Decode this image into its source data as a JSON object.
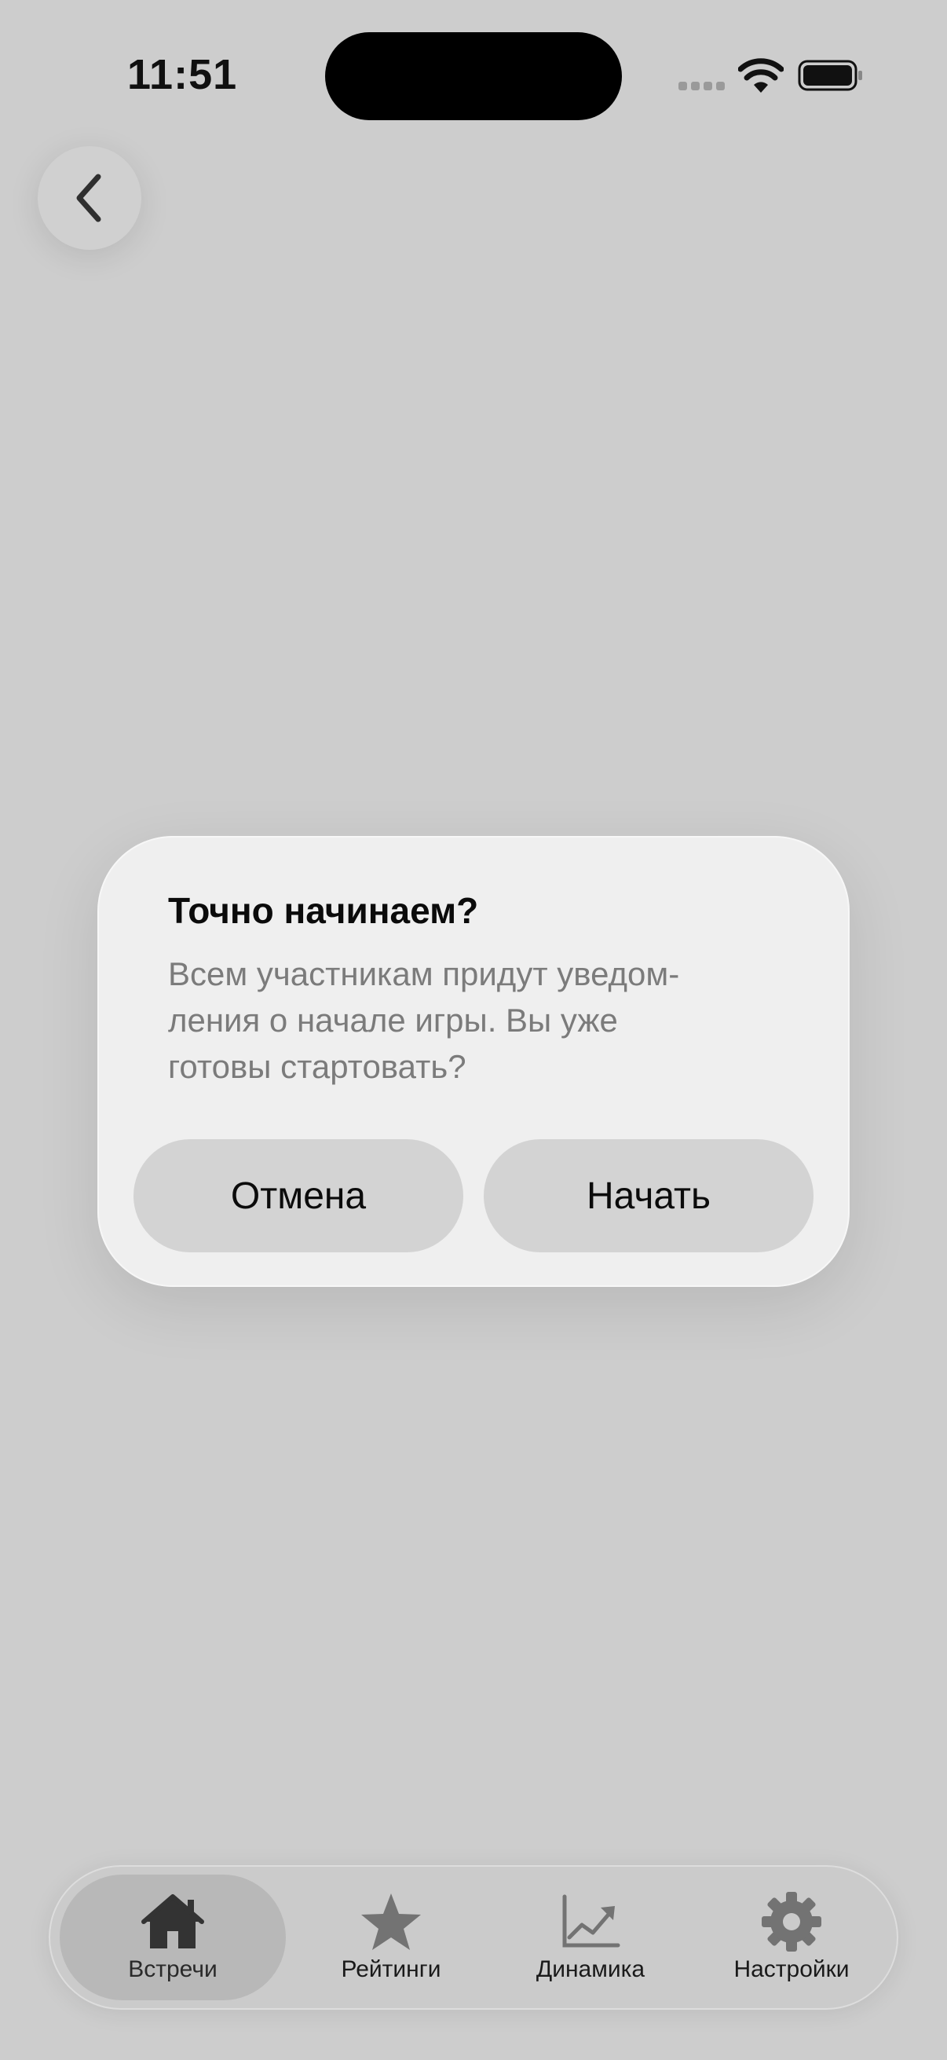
{
  "status_bar": {
    "time": "11:51"
  },
  "dialog": {
    "title": "Точно начинаем?",
    "message_lines": [
      "Всем участникам придут уведом-",
      "ления о начале игры. Вы уже",
      "готовы стартовать?"
    ],
    "cancel_label": "Отмена",
    "confirm_label": "Начать"
  },
  "tab_bar": {
    "items": [
      {
        "label": "Встречи",
        "icon": "house-icon",
        "active": true
      },
      {
        "label": "Рейтинги",
        "icon": "star-icon",
        "active": false
      },
      {
        "label": "Динамика",
        "icon": "chart-line-icon",
        "active": false
      },
      {
        "label": "Настройки",
        "icon": "gear-icon",
        "active": false
      }
    ]
  },
  "colors": {
    "background": "#cdcdcd",
    "dialog_background": "#efefef",
    "button_background": "#d3d3d3",
    "active_tab": "#b8b8b8"
  }
}
